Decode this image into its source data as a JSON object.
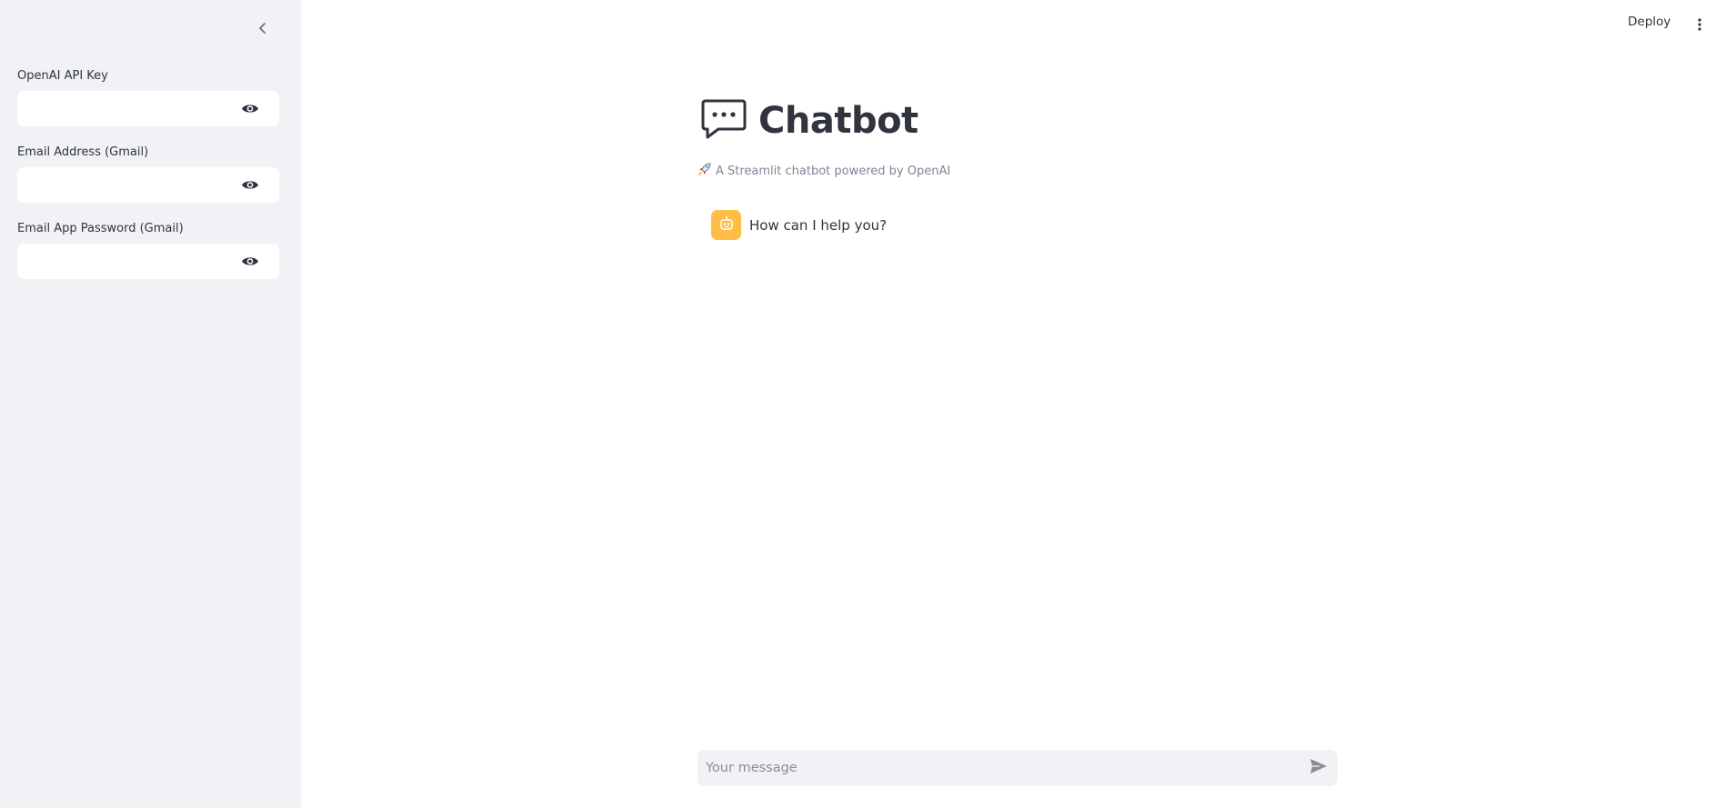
{
  "sidebar": {
    "collapse_icon": "chevron-left-icon",
    "fields": [
      {
        "label": "OpenAI API Key",
        "value": "",
        "placeholder": "",
        "icon": "eye-icon"
      },
      {
        "label": "Email Address (Gmail)",
        "value": "",
        "placeholder": "",
        "icon": "eye-icon"
      },
      {
        "label": "Email App Password (Gmail)",
        "value": "",
        "placeholder": "",
        "icon": "eye-icon"
      }
    ]
  },
  "header": {
    "deploy_label": "Deploy",
    "menu_icon": "more-vertical-icon"
  },
  "main": {
    "title_icon": "speech-bubble-icon",
    "title": "Chatbot",
    "caption_icon": "rocket-icon",
    "caption": "A Streamlit chatbot powered by OpenAI",
    "messages": [
      {
        "role": "assistant",
        "avatar_icon": "robot-icon",
        "text": "How can I help you?"
      }
    ]
  },
  "chat_input": {
    "placeholder": "Your message",
    "value": "",
    "send_icon": "send-icon"
  },
  "colors": {
    "sidebar_bg": "#f0f2f6",
    "text": "#31333f",
    "muted_text": "#808495",
    "avatar_bg": "#ffbd45"
  }
}
